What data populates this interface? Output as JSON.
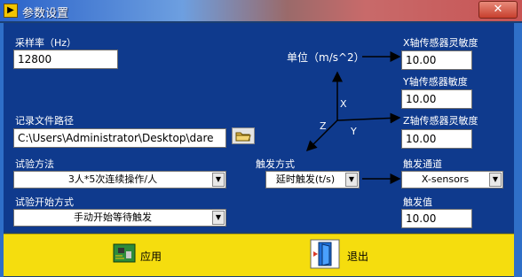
{
  "window": {
    "title": "参数设置",
    "close_glyph": "✕"
  },
  "fields": {
    "sample_rate": {
      "label": "采样率（Hz）",
      "value": "12800"
    },
    "record_path": {
      "label": "记录文件路径",
      "value": "C:\\Users\\Administrator\\Desktop\\dare"
    },
    "x_sensitivity": {
      "label": "X轴传感器灵敏度",
      "value": "10.00"
    },
    "y_sensitivity": {
      "label": "Y轴传感器敏度",
      "value": "10.00"
    },
    "z_sensitivity": {
      "label": "Z轴传感器灵敏度",
      "value": "10.00"
    },
    "trigger_value": {
      "label": "触发值",
      "value": "10.00"
    }
  },
  "selects": {
    "test_method": {
      "label": "试验方法",
      "value": "3人*5次连续操作/人"
    },
    "start_mode": {
      "label": "试验开始方式",
      "value": "手动开始等待触发"
    },
    "trigger_mode": {
      "label": "触发方式",
      "value": "延时触发(t/s)"
    },
    "trigger_channel": {
      "label": "触发通道",
      "value": "X-sensors"
    }
  },
  "diagram": {
    "unit_label": "单位（m/s^2）",
    "axis_x": "X",
    "axis_y": "Y",
    "axis_z": "Z"
  },
  "buttons": {
    "apply": {
      "label": "应用",
      "icon": "circuit-board-icon"
    },
    "exit": {
      "label": "退出",
      "icon": "exit-door-icon"
    }
  },
  "colors": {
    "panel": "#0f3a8d",
    "frame": "#2f6fc8",
    "bottom_bar": "#f5dd0e"
  }
}
